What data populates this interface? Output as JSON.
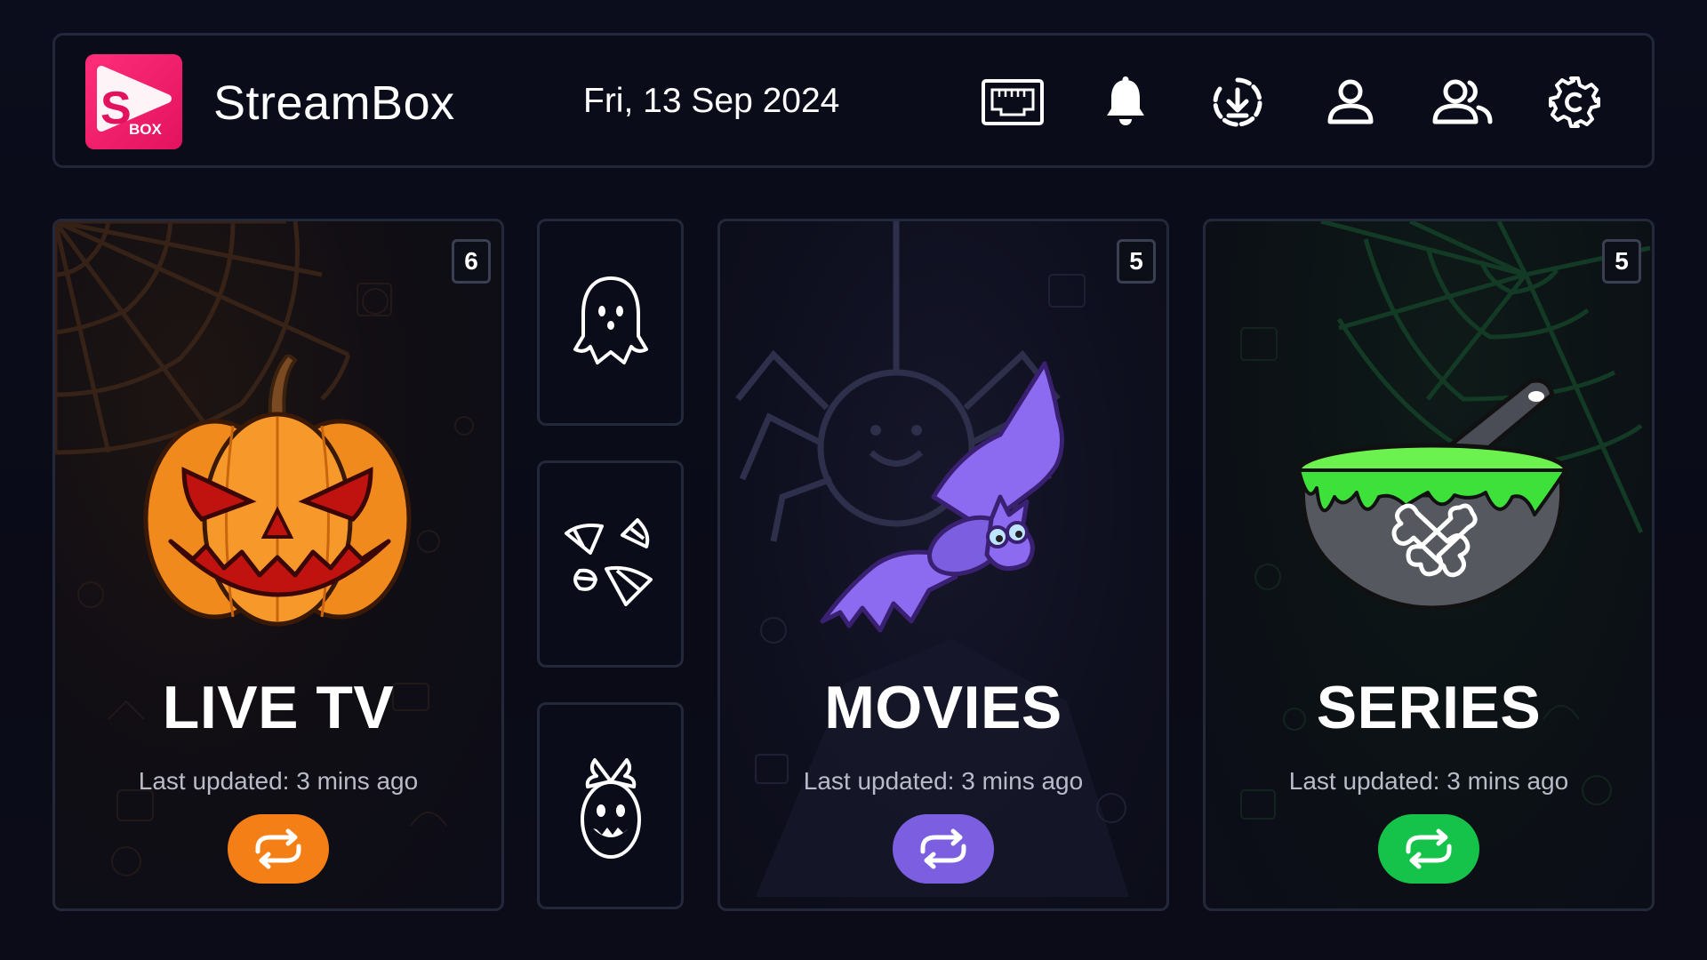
{
  "app": {
    "title": "StreamBox",
    "logo_text": "BOX",
    "logo_letter": "S"
  },
  "header": {
    "date": "Fri, 13 Sep 2024",
    "icons": [
      "ethernet-icon",
      "bell-icon",
      "download-icon",
      "profile-icon",
      "users-icon",
      "settings-icon"
    ]
  },
  "cards": [
    {
      "id": "live",
      "title": "LIVE TV",
      "badge": "6",
      "updated": "Last updated: 3 mins ago",
      "accent": "#f57f17",
      "illustration": "jack-o-lantern"
    },
    {
      "id": "movies",
      "title": "MOVIES",
      "badge": "5",
      "updated": "Last updated: 3 mins ago",
      "accent": "#7b5fe0",
      "illustration": "bat"
    },
    {
      "id": "series",
      "title": "SERIES",
      "badge": "5",
      "updated": "Last updated: 3 mins ago",
      "accent": "#16c34a",
      "illustration": "cauldron"
    }
  ],
  "side_buttons": [
    "ghost-icon",
    "candy-corn-icon",
    "candy-icon"
  ],
  "colors": {
    "background": "#0a0b17",
    "border": "#23283a",
    "logo": "#e8175f",
    "muted_text": "#b9bcc8"
  }
}
